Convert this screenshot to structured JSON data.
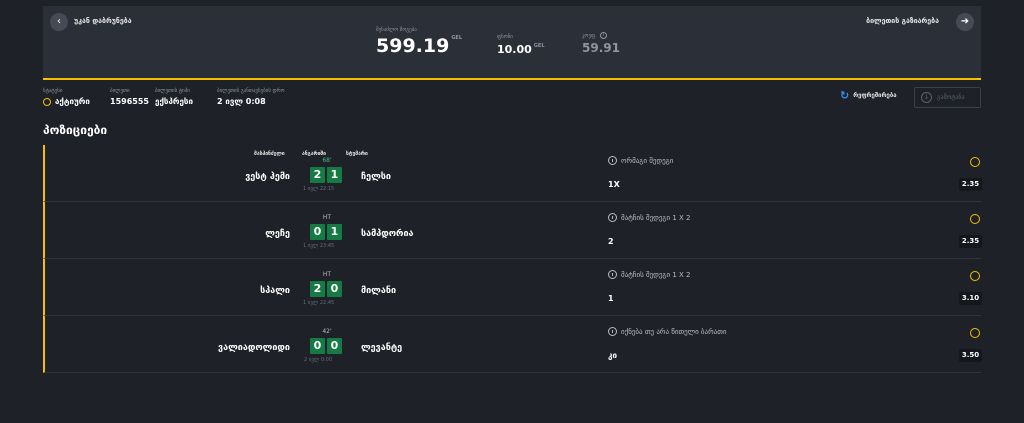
{
  "header": {
    "back_label": "უკან დაბრუნება",
    "share_label": "ბილეთის გაზიარება",
    "back_icon": "arrow-left-icon",
    "share_icon": "arrow-right-icon"
  },
  "summary": {
    "possible_win_label": "შესაძლო მოგება",
    "possible_win_value": "599.19",
    "possible_win_currency": "GEL",
    "stake_label": "ფსონი",
    "stake_value": "10.00",
    "stake_currency": "GEL",
    "odds_label": "კოეფ.",
    "odds_value": "59.91"
  },
  "ticket_meta": {
    "status_label": "სტატუსი",
    "status_value": "აქტიური",
    "ticket_label": "ბილეთი",
    "ticket_value": "1596555",
    "type_label": "ბილეთის ტიპი",
    "type_value": "ექსპრესი",
    "placed_label": "ბილეთის განთავსების დრო",
    "placed_value": "2 ივლ 0:08"
  },
  "actions": {
    "refresh_label": "რეფრეშირება",
    "payout_label": "გამოტანა"
  },
  "positions_title": "პოზიციები",
  "columns": {
    "home": "მასპინძელი",
    "score": "ანგარიში",
    "away": "სტუმარი"
  },
  "events": [
    {
      "minute": "68'",
      "home": "ვესტ ჰემი",
      "home_score": "2",
      "away_score": "1",
      "away": "ჩელსი",
      "kickoff": "1 ივლ 22:15",
      "market": "ორმაგი შედეგი",
      "pick": "1X",
      "odds": "2.35"
    },
    {
      "minute": "HT",
      "home": "ლეჩე",
      "home_score": "0",
      "away_score": "1",
      "away": "სამპდორია",
      "kickoff": "1 ივლ 23:45",
      "market": "მატჩის შედეგი 1 X 2",
      "pick": "2",
      "odds": "2.35"
    },
    {
      "minute": "HT",
      "home": "სპალი",
      "home_score": "2",
      "away_score": "0",
      "away": "მილანი",
      "kickoff": "1 ივლ 22:45",
      "market": "მატჩის შედეგი 1 X 2",
      "pick": "1",
      "odds": "3.10"
    },
    {
      "minute": "42'",
      "home": "ვალიადოლიდი",
      "home_score": "0",
      "away_score": "0",
      "away": "ლევანტე",
      "kickoff": "2 ივლ 0:00",
      "market": "იქნება თუ არა წითელი ბარათი",
      "pick": "კი",
      "odds": "3.50"
    }
  ],
  "colors": {
    "accent": "#f2c200",
    "score_bg": "#167a44",
    "panel": "#2b2f37",
    "background": "#1e2127",
    "refresh": "#2f8ff0"
  }
}
